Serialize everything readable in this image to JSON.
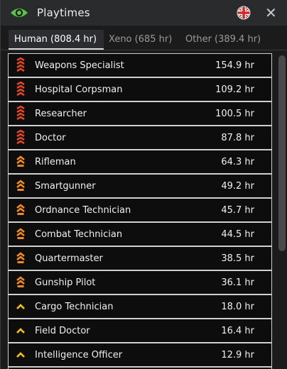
{
  "window": {
    "title": "Playtimes",
    "close_glyph": "✕"
  },
  "tabs": [
    {
      "label": "Human (808.4 hr)",
      "active": true
    },
    {
      "label": "Xeno (685 hr)",
      "active": false
    },
    {
      "label": "Other (389.4 hr)",
      "active": false
    }
  ],
  "colors": {
    "rank_senior": "#e0462a",
    "rank_mid": "#ef8a26",
    "rank_junior": "#f2c318",
    "eye": "#5cc24a"
  },
  "playtimes": [
    {
      "role": "Weapons Specialist",
      "hours": "154.9 hr",
      "rank_icon": "rank-senior-icon"
    },
    {
      "role": "Hospital Corpsman",
      "hours": "109.2 hr",
      "rank_icon": "rank-senior-icon"
    },
    {
      "role": "Researcher",
      "hours": "100.5 hr",
      "rank_icon": "rank-senior-icon"
    },
    {
      "role": "Doctor",
      "hours": "87.8 hr",
      "rank_icon": "rank-senior-icon"
    },
    {
      "role": "Rifleman",
      "hours": "64.3 hr",
      "rank_icon": "rank-mid-icon"
    },
    {
      "role": "Smartgunner",
      "hours": "49.2 hr",
      "rank_icon": "rank-mid-icon"
    },
    {
      "role": "Ordnance Technician",
      "hours": "45.7 hr",
      "rank_icon": "rank-mid-icon"
    },
    {
      "role": "Combat Technician",
      "hours": "44.5 hr",
      "rank_icon": "rank-mid-icon"
    },
    {
      "role": "Quartermaster",
      "hours": "38.5 hr",
      "rank_icon": "rank-mid-icon"
    },
    {
      "role": "Gunship Pilot",
      "hours": "36.1 hr",
      "rank_icon": "rank-mid-icon"
    },
    {
      "role": "Cargo Technician",
      "hours": "18.0 hr",
      "rank_icon": "rank-junior-icon"
    },
    {
      "role": "Field Doctor",
      "hours": "16.4 hr",
      "rank_icon": "rank-junior-icon"
    },
    {
      "role": "Intelligence Officer",
      "hours": "12.9 hr",
      "rank_icon": "rank-junior-icon"
    },
    {
      "role": "",
      "hours": "",
      "rank_icon": ""
    }
  ]
}
